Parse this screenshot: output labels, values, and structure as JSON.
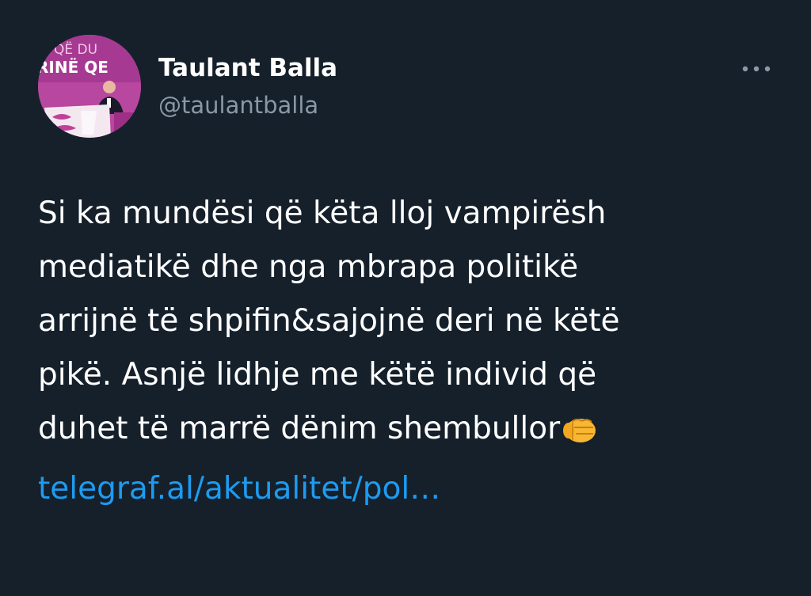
{
  "author": {
    "name": "Taulant Balla",
    "handle": "@taulantballa",
    "avatar_text_top": "QË DU",
    "avatar_text_bottom": "RINË QE"
  },
  "more_icon": "more-horizontal-icon",
  "tweet": {
    "lines": [
      "Si ka mundësi që këta lloj vampirësh",
      "mediatikë dhe nga mbrapa politikë",
      "arrijnë të shpifin&sajojnë deri në këtë",
      "pikë. Asnjë lidhje me këtë individ që",
      "duhet të marrë dënim shembullor"
    ],
    "emoji": "oncoming-fist-emoji",
    "link": "telegraf.al/aktualitet/pol…"
  },
  "colors": {
    "background": "#15202b",
    "text": "#ffffff",
    "secondary_text": "#8b98a5",
    "link": "#1d9bf0",
    "avatar_bg": "#b8479f"
  }
}
